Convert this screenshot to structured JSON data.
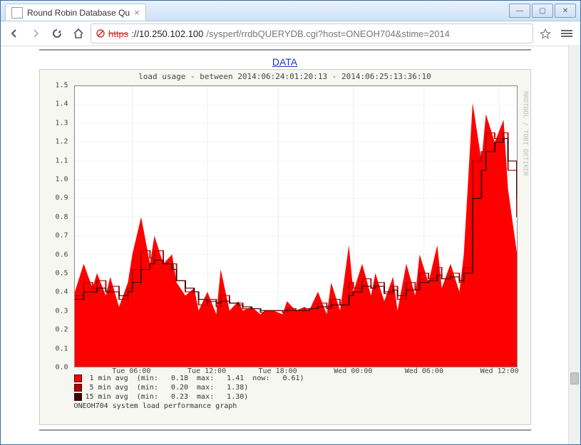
{
  "window": {
    "tab_title": "Round Robin Database Qu"
  },
  "win_btns": {
    "min": "—",
    "max": "▢",
    "close": "✕"
  },
  "toolbar": {
    "url_https": "https",
    "url_host": "://10.250.102.100",
    "url_path": "/sysperf/rrdbQUERYDB.cgi?host=ONEOH704&stime=2014"
  },
  "page": {
    "data_label": "DATA",
    "title": "load usage - between 2014:06:24:01:20:13 - 2014:06:25:13:36:10",
    "watermark": "RRDTOOL / TOBI OETIKER",
    "legend": {
      "l1": " 1 min avg  (min:   0.18  max:   1.41  now:   0.61)",
      "l2": " 5 min avg  (min:   0.20  max:   1.38)",
      "l3": "15 min avg  (min:   0.23  max:   1.30)",
      "footer": "ONEOH704 system load performance graph"
    },
    "colors": {
      "c1": "#ff0000",
      "c2": "#b00000",
      "c3": "#400000"
    }
  },
  "chart_data": {
    "type": "area",
    "ylim": [
      0,
      1.5
    ],
    "yticks": [
      0.0,
      0.1,
      0.2,
      0.3,
      0.4,
      0.5,
      0.6,
      0.7,
      0.8,
      0.9,
      1.0,
      1.1,
      1.2,
      1.3,
      1.4,
      1.5
    ],
    "xticks": [
      "Tue 06:00",
      "Tue 12:00",
      "Tue 18:00",
      "Wed 00:00",
      "Wed 06:00",
      "Wed 12:00"
    ],
    "xtick_pos": [
      0.13,
      0.3,
      0.46,
      0.63,
      0.79,
      0.96
    ],
    "x": [
      0.0,
      0.02,
      0.04,
      0.05,
      0.07,
      0.08,
      0.1,
      0.12,
      0.13,
      0.15,
      0.17,
      0.18,
      0.2,
      0.22,
      0.23,
      0.25,
      0.27,
      0.28,
      0.3,
      0.32,
      0.33,
      0.35,
      0.37,
      0.38,
      0.4,
      0.42,
      0.43,
      0.45,
      0.47,
      0.48,
      0.5,
      0.52,
      0.53,
      0.55,
      0.57,
      0.58,
      0.6,
      0.62,
      0.63,
      0.65,
      0.67,
      0.68,
      0.7,
      0.72,
      0.73,
      0.75,
      0.77,
      0.78,
      0.8,
      0.82,
      0.83,
      0.85,
      0.87,
      0.88,
      0.9,
      0.92,
      0.93,
      0.95,
      0.97,
      0.98,
      1.0
    ],
    "one_min": [
      0.4,
      0.55,
      0.42,
      0.5,
      0.38,
      0.48,
      0.32,
      0.45,
      0.6,
      0.8,
      0.55,
      0.7,
      0.55,
      0.6,
      0.45,
      0.38,
      0.42,
      0.3,
      0.4,
      0.28,
      0.52,
      0.3,
      0.35,
      0.3,
      0.32,
      0.28,
      0.3,
      0.3,
      0.28,
      0.35,
      0.3,
      0.32,
      0.3,
      0.4,
      0.28,
      0.45,
      0.3,
      0.65,
      0.4,
      0.55,
      0.38,
      0.5,
      0.35,
      0.48,
      0.3,
      0.55,
      0.38,
      0.6,
      0.45,
      0.65,
      0.42,
      0.55,
      0.4,
      0.6,
      1.41,
      1.1,
      1.35,
      1.2,
      1.32,
      0.95,
      0.61
    ],
    "five_min": [
      0.38,
      0.45,
      0.42,
      0.46,
      0.4,
      0.43,
      0.36,
      0.42,
      0.52,
      0.62,
      0.58,
      0.62,
      0.55,
      0.55,
      0.46,
      0.4,
      0.4,
      0.33,
      0.36,
      0.32,
      0.38,
      0.34,
      0.34,
      0.31,
      0.31,
      0.29,
      0.3,
      0.3,
      0.29,
      0.31,
      0.3,
      0.31,
      0.31,
      0.34,
      0.31,
      0.36,
      0.33,
      0.45,
      0.42,
      0.47,
      0.42,
      0.45,
      0.39,
      0.43,
      0.36,
      0.45,
      0.41,
      0.5,
      0.47,
      0.53,
      0.47,
      0.5,
      0.45,
      0.53,
      1.1,
      1.15,
      1.25,
      1.22,
      1.25,
      1.05,
      0.8
    ],
    "fifteen_min": [
      0.36,
      0.4,
      0.4,
      0.42,
      0.4,
      0.4,
      0.38,
      0.4,
      0.45,
      0.52,
      0.55,
      0.57,
      0.55,
      0.52,
      0.46,
      0.42,
      0.4,
      0.36,
      0.35,
      0.34,
      0.35,
      0.34,
      0.33,
      0.32,
      0.31,
      0.3,
      0.3,
      0.3,
      0.3,
      0.3,
      0.3,
      0.3,
      0.31,
      0.32,
      0.32,
      0.33,
      0.33,
      0.38,
      0.4,
      0.43,
      0.42,
      0.43,
      0.4,
      0.41,
      0.38,
      0.41,
      0.41,
      0.45,
      0.46,
      0.49,
      0.47,
      0.48,
      0.46,
      0.5,
      0.9,
      1.05,
      1.15,
      1.2,
      1.22,
      1.1,
      0.9
    ]
  }
}
